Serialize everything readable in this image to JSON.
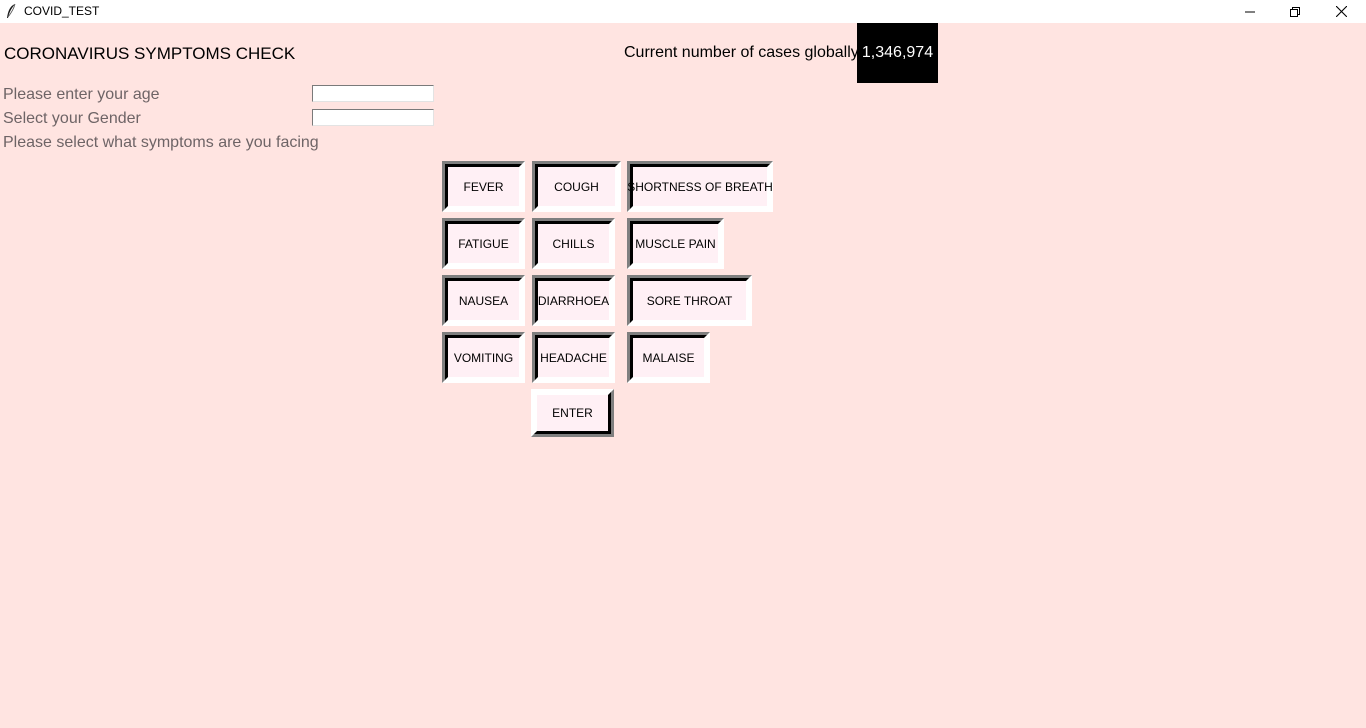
{
  "window": {
    "title": "COVID_TEST",
    "background": "#ffe4e1"
  },
  "header": {
    "title": "CORONAVIRUS SYMPTOMS CHECK",
    "cases_label": "Current number of cases globally:",
    "cases_value": "1,346,974"
  },
  "form": {
    "age_label": "Please enter your age",
    "age_value": "",
    "gender_label": "Select your Gender",
    "gender_value": "",
    "symptoms_label": "Please select what symptoms are you facing"
  },
  "symptoms": {
    "fever": "FEVER",
    "cough": "COUGH",
    "shortness_of_breath": "SHORTNESS OF BREATH",
    "fatigue": "FATIGUE",
    "chills": "CHILLS",
    "muscle_pain": "MUSCLE PAIN",
    "nausea": "NAUSEA",
    "diarrhoea": "DIARRHOEA",
    "sore_throat": "SORE THROAT",
    "vomiting": "VOMITING",
    "headache": "HEADACHE",
    "malaise": "MALAISE"
  },
  "actions": {
    "enter_label": "ENTER"
  }
}
